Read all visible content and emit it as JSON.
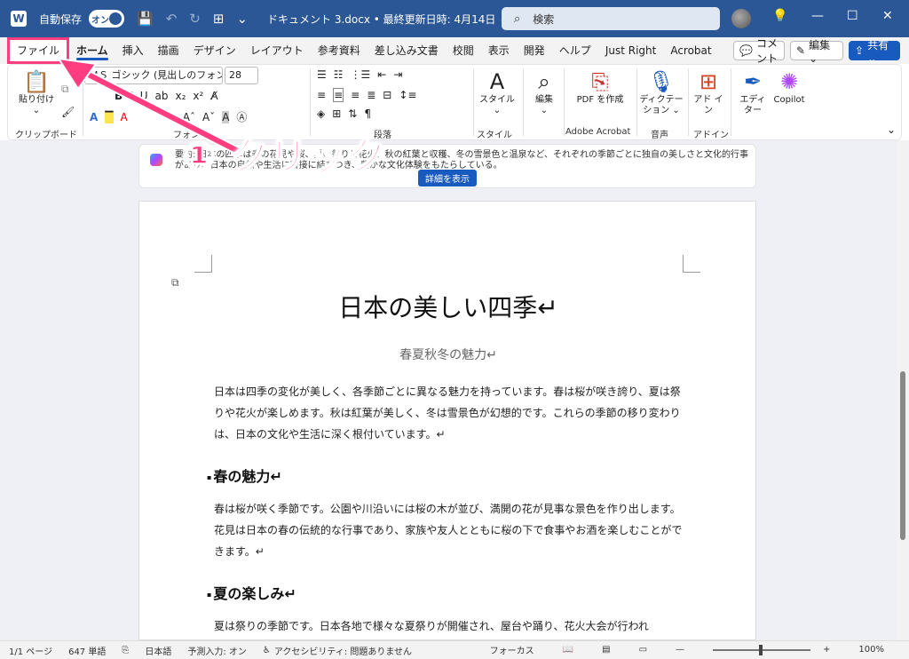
{
  "titlebar": {
    "app_letter": "W",
    "autosave_label": "自動保存",
    "autosave_state": "オン",
    "doc_title": "ドキュメント 3.docx • 最終更新日時: 4月14日 ⌄",
    "search_placeholder": "検索"
  },
  "tabs": [
    "ファイル",
    "ホーム",
    "挿入",
    "描画",
    "デザイン",
    "レイアウト",
    "参考資料",
    "差し込み文書",
    "校閲",
    "表示",
    "開発",
    "ヘルプ",
    "Just Right",
    "Acrobat"
  ],
  "ribbon_buttons": {
    "comment": "コメント",
    "edit": "編集 ⌄",
    "share": "共有 ⌄"
  },
  "ribbon": {
    "paste": "貼り付け",
    "clipboard_group": "クリップボード",
    "font_name": "ＭＳ ゴシック (見出しのフォント -",
    "font_size": "28",
    "font_group": "フォント",
    "paragraph_group": "段落",
    "style": "スタイル",
    "style_group": "スタイル",
    "editing": "編集",
    "pdf": "PDF を作成",
    "acrobat_group": "Adobe Acrobat",
    "dictation": "ディクテーション ⌄",
    "voice_group": "音声",
    "addin": "アド イン",
    "addin_group": "アドイン",
    "editor": "エディター",
    "copilot": "Copilot"
  },
  "banner": {
    "text": "要約: 日本の四季は春の花見や桜、夏の祭りと花火、秋の紅葉と収穫、冬の雪景色と温泉など、それぞれの季節ごとに独自の美しさと文化的行事があり、日本の自然や生活に密接に結びつき、豊かな文化体験をもたらしている。",
    "more_button": "詳細を表示"
  },
  "document": {
    "title": "日本の美しい四季↵",
    "subtitle": "春夏秋冬の魅力↵",
    "intro": "日本は四季の変化が美しく、各季節ごとに異なる魅力を持っています。春は桜が咲き誇り、夏は祭りや花火が楽しめます。秋は紅葉が美しく、冬は雪景色が幻想的です。これらの季節の移り変わりは、日本の文化や生活に深く根付いています。↵",
    "h_spring": "春の魅力↵",
    "p_spring": "春は桜が咲く季節です。公園や川沿いには桜の木が並び、満開の花が見事な景色を作り出します。花見は日本の春の伝統的な行事であり、家族や友人とともに桜の下で食事やお酒を楽しむことができます。↵",
    "h_summer": "夏の楽しみ↵",
    "p_summer": "夏は祭りの季節です。日本各地で様々な夏祭りが開催され、屋台や踊り、花火大会が行われ"
  },
  "status": {
    "page": "1/1 ページ",
    "words": "647 単語",
    "language": "日本語",
    "predict": "予測入力: オン",
    "accessibility": "アクセシビリティ: 問題ありません",
    "focus": "フォーカス",
    "zoom": "100%"
  },
  "annotation": {
    "callout": "① クリック"
  }
}
